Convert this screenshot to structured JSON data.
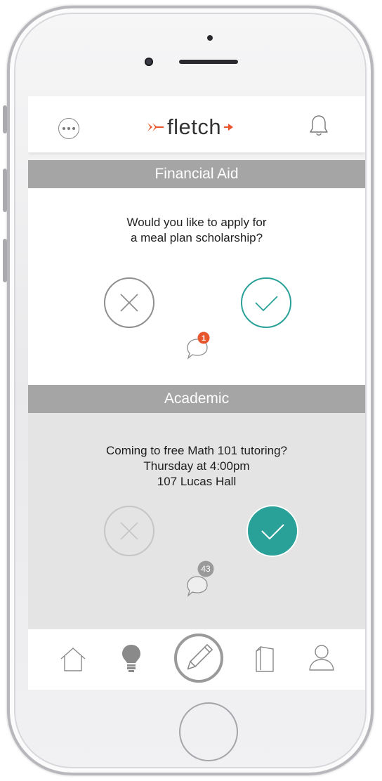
{
  "app": {
    "name": "fletch",
    "brand_color": "#e8562e",
    "accent_color": "#2aa198",
    "header_color": "#a5a5a5"
  },
  "header": {
    "menu_icon": "ellipsis-icon",
    "bell_icon": "bell-icon"
  },
  "cards": [
    {
      "section": "Financial Aid",
      "question_lines": [
        "Would you like to apply for",
        "a meal plan scholarship?"
      ],
      "decline_icon": "x-icon",
      "accept_icon": "check-icon",
      "comment_count": "1",
      "comment_badge_color": "#e8562e"
    },
    {
      "section": "Academic",
      "question_lines": [
        "Coming to free Math 101 tutoring?",
        "Thursday at 4:00pm",
        "107 Lucas Hall"
      ],
      "decline_icon": "x-icon",
      "accept_icon": "check-icon",
      "accept_selected": true,
      "comment_count": "43",
      "comment_badge_color": "#9a9a9a"
    }
  ],
  "tabbar": {
    "tabs": [
      "home-icon",
      "lightbulb-icon",
      "pencil-icon",
      "document-icon",
      "profile-icon"
    ],
    "active": "pencil-icon"
  }
}
